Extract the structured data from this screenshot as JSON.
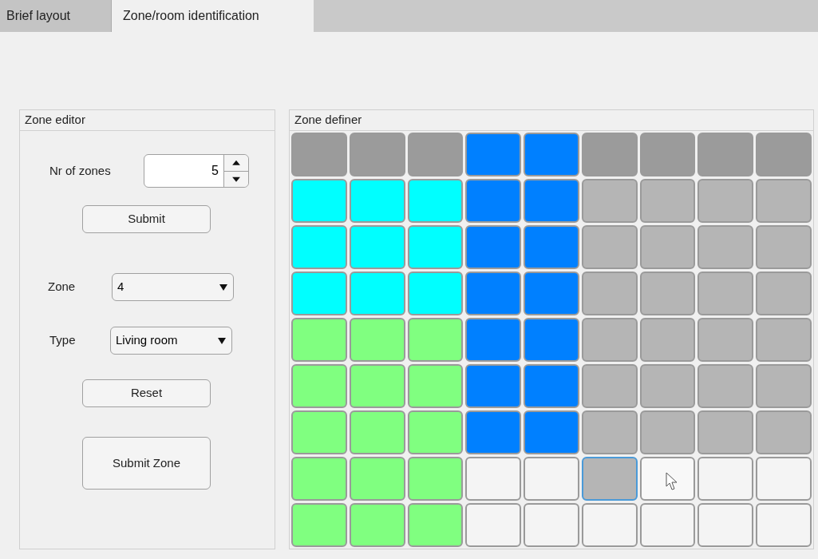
{
  "tabs": [
    {
      "label": "Brief layout",
      "selected": false
    },
    {
      "label": "Zone/room identification",
      "selected": true
    }
  ],
  "zone_editor": {
    "title": "Zone editor",
    "nr_of_zones": {
      "label": "Nr of zones",
      "value": "5"
    },
    "submit_button": "Submit",
    "zone": {
      "label": "Zone",
      "value": "4"
    },
    "type": {
      "label": "Type",
      "value": "Living room"
    },
    "reset_button": "Reset",
    "submit_zone_button": "Submit Zone"
  },
  "zone_definer": {
    "title": "Zone definer",
    "rows": [
      [
        {
          "color": "#9b9b9b",
          "focused": false
        },
        {
          "color": "#9b9b9b",
          "focused": false
        },
        {
          "color": "#9b9b9b",
          "focused": false
        },
        {
          "color": "#0080ff",
          "focused": false
        },
        {
          "color": "#0080ff",
          "focused": false
        },
        {
          "color": "#9b9b9b",
          "focused": false
        },
        {
          "color": "#9b9b9b",
          "focused": false
        },
        {
          "color": "#9b9b9b",
          "focused": false
        },
        {
          "color": "#9b9b9b",
          "focused": false
        }
      ],
      [
        {
          "color": "#00ffff",
          "focused": false
        },
        {
          "color": "#00ffff",
          "focused": false
        },
        {
          "color": "#00ffff",
          "focused": false
        },
        {
          "color": "#0080ff",
          "focused": false
        },
        {
          "color": "#0080ff",
          "focused": false
        },
        {
          "color": "#b5b5b5",
          "focused": false
        },
        {
          "color": "#b5b5b5",
          "focused": false
        },
        {
          "color": "#b5b5b5",
          "focused": false
        },
        {
          "color": "#b5b5b5",
          "focused": false
        }
      ],
      [
        {
          "color": "#00ffff",
          "focused": false
        },
        {
          "color": "#00ffff",
          "focused": false
        },
        {
          "color": "#00ffff",
          "focused": false
        },
        {
          "color": "#0080ff",
          "focused": false
        },
        {
          "color": "#0080ff",
          "focused": false
        },
        {
          "color": "#b5b5b5",
          "focused": false
        },
        {
          "color": "#b5b5b5",
          "focused": false
        },
        {
          "color": "#b5b5b5",
          "focused": false
        },
        {
          "color": "#b5b5b5",
          "focused": false
        }
      ],
      [
        {
          "color": "#00ffff",
          "focused": false
        },
        {
          "color": "#00ffff",
          "focused": false
        },
        {
          "color": "#00ffff",
          "focused": false
        },
        {
          "color": "#0080ff",
          "focused": false
        },
        {
          "color": "#0080ff",
          "focused": false
        },
        {
          "color": "#b5b5b5",
          "focused": false
        },
        {
          "color": "#b5b5b5",
          "focused": false
        },
        {
          "color": "#b5b5b5",
          "focused": false
        },
        {
          "color": "#b5b5b5",
          "focused": false
        }
      ],
      [
        {
          "color": "#80ff80",
          "focused": false
        },
        {
          "color": "#80ff80",
          "focused": false
        },
        {
          "color": "#80ff80",
          "focused": false
        },
        {
          "color": "#0080ff",
          "focused": false
        },
        {
          "color": "#0080ff",
          "focused": false
        },
        {
          "color": "#b5b5b5",
          "focused": false
        },
        {
          "color": "#b5b5b5",
          "focused": false
        },
        {
          "color": "#b5b5b5",
          "focused": false
        },
        {
          "color": "#b5b5b5",
          "focused": false
        }
      ],
      [
        {
          "color": "#80ff80",
          "focused": false
        },
        {
          "color": "#80ff80",
          "focused": false
        },
        {
          "color": "#80ff80",
          "focused": false
        },
        {
          "color": "#0080ff",
          "focused": false
        },
        {
          "color": "#0080ff",
          "focused": false
        },
        {
          "color": "#b5b5b5",
          "focused": false
        },
        {
          "color": "#b5b5b5",
          "focused": false
        },
        {
          "color": "#b5b5b5",
          "focused": false
        },
        {
          "color": "#b5b5b5",
          "focused": false
        }
      ],
      [
        {
          "color": "#80ff80",
          "focused": false
        },
        {
          "color": "#80ff80",
          "focused": false
        },
        {
          "color": "#80ff80",
          "focused": false
        },
        {
          "color": "#0080ff",
          "focused": false
        },
        {
          "color": "#0080ff",
          "focused": false
        },
        {
          "color": "#b5b5b5",
          "focused": false
        },
        {
          "color": "#b5b5b5",
          "focused": false
        },
        {
          "color": "#b5b5b5",
          "focused": false
        },
        {
          "color": "#b5b5b5",
          "focused": false
        }
      ],
      [
        {
          "color": "#80ff80",
          "focused": false
        },
        {
          "color": "#80ff80",
          "focused": false
        },
        {
          "color": "#80ff80",
          "focused": false
        },
        {
          "color": "#f4f4f4",
          "focused": false
        },
        {
          "color": "#f4f4f4",
          "focused": false
        },
        {
          "color": "#b5b5b5",
          "focused": true
        },
        {
          "color": "#f8f8f8",
          "focused": false
        },
        {
          "color": "#f4f4f4",
          "focused": false
        },
        {
          "color": "#f4f4f4",
          "focused": false
        }
      ],
      [
        {
          "color": "#80ff80",
          "focused": false
        },
        {
          "color": "#80ff80",
          "focused": false
        },
        {
          "color": "#80ff80",
          "focused": false
        },
        {
          "color": "#f4f4f4",
          "focused": false
        },
        {
          "color": "#f4f4f4",
          "focused": false
        },
        {
          "color": "#f4f4f4",
          "focused": false
        },
        {
          "color": "#f4f4f4",
          "focused": false
        },
        {
          "color": "#f4f4f4",
          "focused": false
        },
        {
          "color": "#f4f4f4",
          "focused": false
        }
      ]
    ]
  }
}
